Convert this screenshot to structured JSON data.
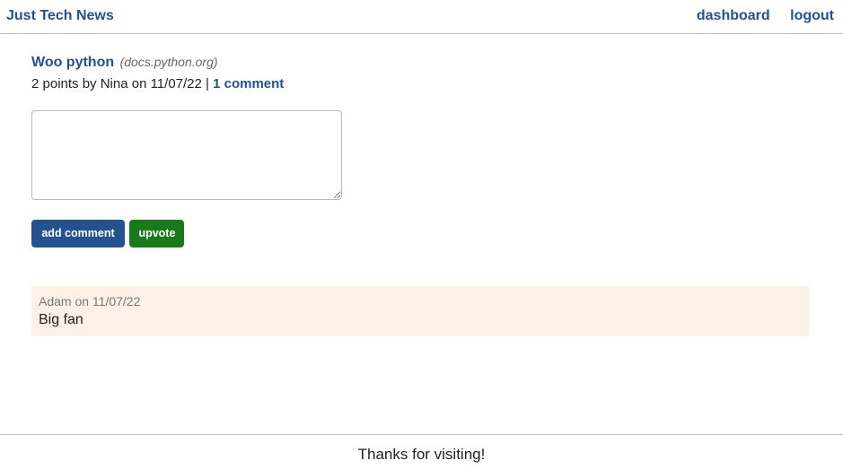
{
  "header": {
    "brand": "Just Tech News",
    "nav": {
      "dashboard": "dashboard",
      "logout": "logout"
    }
  },
  "post": {
    "title": "Woo python",
    "domain": "(docs.python.org)",
    "meta_prefix": "2 points by Nina on 11/07/22 |",
    "comment_link": "1 comment"
  },
  "comment_form": {
    "textarea_value": "",
    "add_comment_label": "add comment",
    "upvote_label": "upvote"
  },
  "comments": [
    {
      "meta": "Adam on 11/07/22",
      "text": "Big fan"
    }
  ],
  "footer": {
    "text": "Thanks for visiting!"
  },
  "colors": {
    "link": "#24528f",
    "upvote": "#1a7a1a",
    "comment_bg": "#fdf0e4"
  }
}
